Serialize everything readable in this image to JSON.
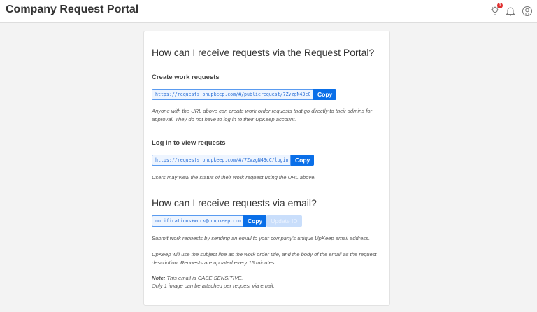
{
  "header": {
    "title": "Company Request Portal",
    "notification_count": "1"
  },
  "portal": {
    "heading": "How can I receive requests via the Request Portal?",
    "create": {
      "label": "Create work requests",
      "url": "https://requests.onupkeep.com/#/publicrequest/7ZvzgN43cC",
      "copy": "Copy",
      "description": "Anyone with the URL above can create work order requests that go directly to their admins for approval. They do not have to log in to their UpKeep account."
    },
    "login": {
      "label": "Log in to view requests",
      "url": "https://requests.onupkeep.com/#/7ZvzgN43cC/login",
      "copy": "Copy",
      "description": "Users may view the status of their work request using the URL above."
    }
  },
  "email": {
    "heading": "How can I receive requests via email?",
    "address": "notifications+work@onupkeep.com",
    "copy": "Copy",
    "update": "Update ID",
    "p1": "Submit work requests by sending an email to your company's unique UpKeep email address.",
    "p2": "UpKeep will use the subject line as the work order title, and the body of the email as the request description. Requests are updated every 15 minutes.",
    "note_label": "Note:",
    "note_text": " This email is CASE SENSITIVE.",
    "p3": "Only 1 image can be attached per request via email."
  }
}
